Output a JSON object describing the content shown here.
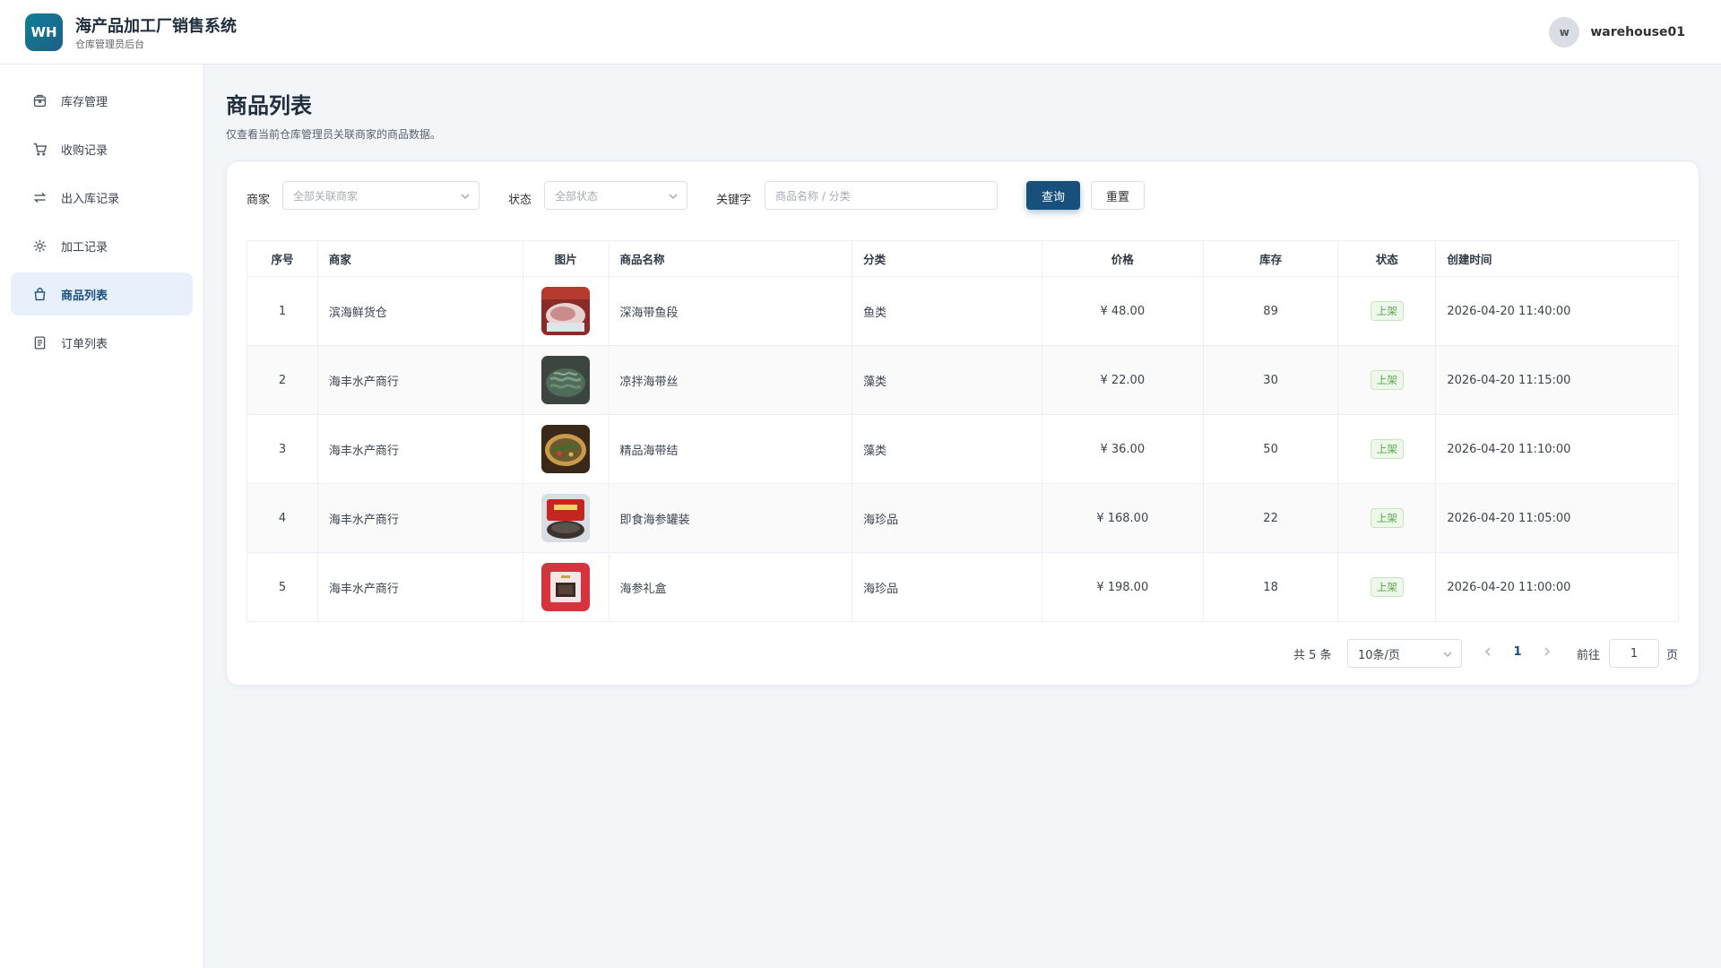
{
  "header": {
    "logo_text": "WH",
    "title": "海产品加工厂销售系统",
    "subtitle": "仓库管理员后台",
    "user_initial": "w",
    "username": "warehouse01"
  },
  "sidebar": {
    "items": [
      {
        "label": "库存管理",
        "icon": "inventory-icon",
        "active": false
      },
      {
        "label": "收购记录",
        "icon": "cart-icon",
        "active": false
      },
      {
        "label": "出入库记录",
        "icon": "transfer-icon",
        "active": false
      },
      {
        "label": "加工记录",
        "icon": "gear-icon",
        "active": false
      },
      {
        "label": "商品列表",
        "icon": "bag-icon",
        "active": true
      },
      {
        "label": "订单列表",
        "icon": "document-icon",
        "active": false
      }
    ]
  },
  "main": {
    "title": "商品列表",
    "description": "仅查看当前仓库管理员关联商家的商品数据。"
  },
  "filters": {
    "merchant_label": "商家",
    "merchant_placeholder": "全部关联商家",
    "status_label": "状态",
    "status_placeholder": "全部状态",
    "keyword_label": "关键字",
    "keyword_placeholder": "商品名称 / 分类",
    "search_button": "查询",
    "reset_button": "重置"
  },
  "table": {
    "columns": [
      "序号",
      "商家",
      "图片",
      "商品名称",
      "分类",
      "价格",
      "库存",
      "状态",
      "创建时间"
    ],
    "rows": [
      {
        "index": "1",
        "merchant": "滨海鲜货仓",
        "name": "深海带鱼段",
        "category": "鱼类",
        "price": "¥ 48.00",
        "stock": "89",
        "status": "上架",
        "created": "2026-04-20 11:40:00",
        "image": "fish-image"
      },
      {
        "index": "2",
        "merchant": "海丰水产商行",
        "name": "凉拌海带丝",
        "category": "藻类",
        "price": "¥ 22.00",
        "stock": "30",
        "status": "上架",
        "created": "2026-04-20 11:15:00",
        "image": "kelp-strips-image"
      },
      {
        "index": "3",
        "merchant": "海丰水产商行",
        "name": "精品海带结",
        "category": "藻类",
        "price": "¥ 36.00",
        "stock": "50",
        "status": "上架",
        "created": "2026-04-20 11:10:00",
        "image": "kelp-knot-image"
      },
      {
        "index": "4",
        "merchant": "海丰水产商行",
        "name": "即食海参罐装",
        "category": "海珍品",
        "price": "¥ 168.00",
        "stock": "22",
        "status": "上架",
        "created": "2026-04-20 11:05:00",
        "image": "sea-cucumber-can-image"
      },
      {
        "index": "5",
        "merchant": "海丰水产商行",
        "name": "海参礼盒",
        "category": "海珍品",
        "price": "¥ 198.00",
        "stock": "18",
        "status": "上架",
        "created": "2026-04-20 11:00:00",
        "image": "gift-box-image"
      }
    ]
  },
  "pagination": {
    "total_text": "共 5 条",
    "page_size": "10条/页",
    "current_page": "1",
    "goto_label": "前往",
    "goto_value": "1",
    "goto_unit": "页"
  },
  "colors": {
    "primary": "#174f7d",
    "active_nav_bg": "#e8f1fb",
    "status_tag": "#56a54c"
  }
}
